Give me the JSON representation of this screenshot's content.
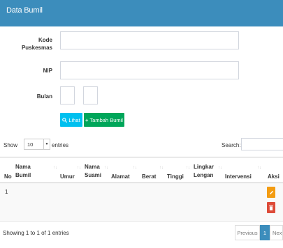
{
  "header": {
    "title": "Data Bumil"
  },
  "form": {
    "kode_label": "Kode",
    "kode_label2": "Puskesmas",
    "kode_value": "",
    "nip_label": "NIP",
    "nip_value": "",
    "bulan_label": "Bulan",
    "bulan_value1": "",
    "bulan_value2": "",
    "lihat_button": "Lihat",
    "tambah_button": "Tambah Bumil"
  },
  "table_controls": {
    "show_label": "Show",
    "entries_value": "10",
    "entries_label": "entries",
    "search_label": "Search:",
    "search_value": ""
  },
  "table": {
    "columns": [
      {
        "l1": "",
        "l2": "No"
      },
      {
        "l1": "Nama",
        "l2": "Bumil"
      },
      {
        "l1": "",
        "l2": "Umur"
      },
      {
        "l1": "Nama",
        "l2": "Suami"
      },
      {
        "l1": "",
        "l2": "Alamat"
      },
      {
        "l1": "",
        "l2": "Berat"
      },
      {
        "l1": "",
        "l2": "Tinggi"
      },
      {
        "l1": "Lingkar",
        "l2": "Lengan"
      },
      {
        "l1": "",
        "l2": "Intervensi"
      },
      {
        "l1": "",
        "l2": "Aksi"
      }
    ],
    "rows": [
      {
        "no": "1"
      }
    ]
  },
  "footer": {
    "info": "Showing 1 to 1 of 1 entries",
    "previous": "Previous",
    "page": "1",
    "next": "Next"
  },
  "colors": {
    "header": "#3c8dbc",
    "info": "#00c0ef",
    "success": "#00a65a",
    "warning": "#f39c12",
    "danger": "#dd4b39"
  }
}
